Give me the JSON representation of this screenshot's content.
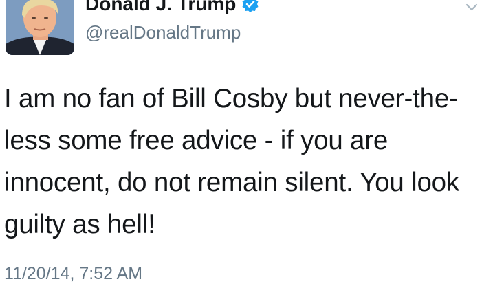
{
  "author": {
    "display_name": "Donald J. Trump",
    "handle": "@realDonaldTrump",
    "verified": true,
    "avatar_icon": "profile-photo"
  },
  "tweet": {
    "text": "I am no fan of Bill Cosby but never-the-\nless some free advice - if you are\ninnocent, do not remain silent. You look\nguilty as hell!",
    "timestamp": "11/20/14, 7:52 AM"
  },
  "icons": {
    "verified": "verified-badge-icon",
    "menu": "chevron-down-icon"
  },
  "colors": {
    "verified_blue": "#1da1f2",
    "secondary_text": "#657786",
    "primary_text": "#14171a"
  }
}
